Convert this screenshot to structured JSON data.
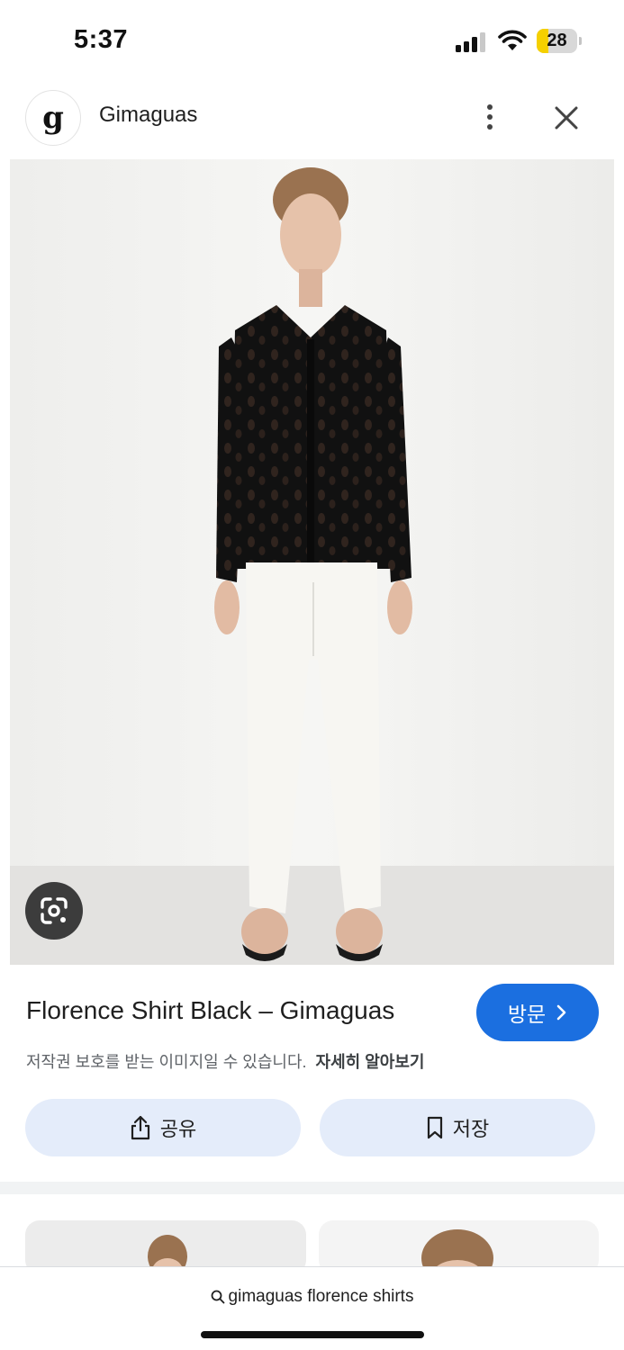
{
  "status_bar": {
    "time": "5:37",
    "battery_level": "28",
    "battery_fraction": 0.28,
    "battery_color": "#f5d000",
    "icons": [
      "signal-icon",
      "wifi-icon",
      "battery-icon"
    ]
  },
  "header": {
    "logo_letter": "g",
    "site_name": "Gimaguas",
    "icons": [
      "more-vert-icon",
      "close-icon"
    ]
  },
  "image": {
    "lens_icon": "google-lens-icon"
  },
  "result": {
    "title": "Florence Shirt Black – Gimaguas",
    "visit_label": "방문",
    "visit_color": "#1b6fe0",
    "copyright_notice": "저작권 보호를 받는 이미지일 수 있습니다.",
    "learn_more_label": "자세히 알아보기"
  },
  "actions": {
    "share_label": "공유",
    "save_label": "저장",
    "button_color": "#e4ecfa"
  },
  "search": {
    "query": "gimaguas florence shirts"
  }
}
